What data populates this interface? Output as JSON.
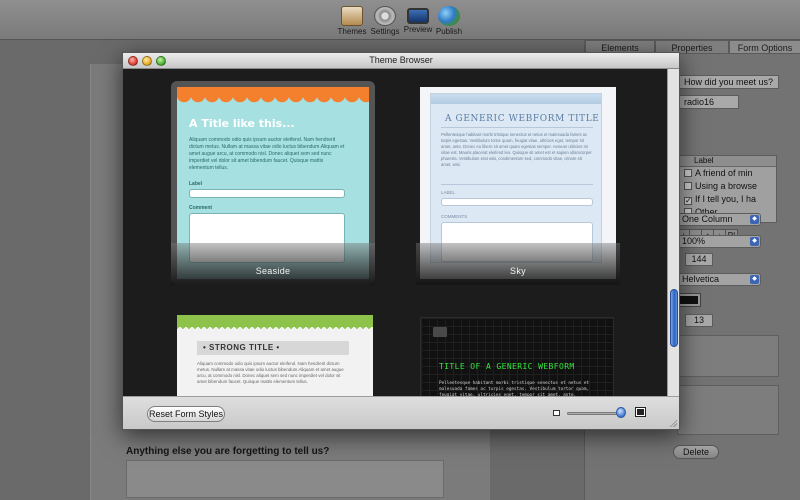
{
  "toolbar": {
    "buttons": [
      {
        "label": "Themes",
        "icon": "themes-icon"
      },
      {
        "label": "Settings",
        "icon": "gear-icon"
      },
      {
        "label": "Preview",
        "icon": "monitor-icon"
      },
      {
        "label": "Publish",
        "icon": "globe-icon"
      }
    ]
  },
  "inspector": {
    "tabs": [
      "Elements",
      "Properties",
      "Form Options"
    ],
    "question_field": "How did you meet us?",
    "name_field": "radio16",
    "list_header": "Label",
    "list_items": [
      {
        "label": "A friend of min",
        "checked": false
      },
      {
        "label": "Using a browse",
        "checked": false
      },
      {
        "label": "If I tell you, I ha",
        "checked": true
      },
      {
        "label": "Other...",
        "checked": false
      }
    ],
    "list_tools": [
      "+",
      "-",
      "↑",
      "↓",
      "P|"
    ],
    "layout_select": "One Column",
    "width_select": "100%",
    "width_value": "144",
    "font_select": "Helvetica",
    "font_size": "13",
    "delete_label": "Delete"
  },
  "background": {
    "bottom_question": "Anything else you are forgetting to tell us?"
  },
  "theme_browser": {
    "title": "Theme Browser",
    "reset_label": "Reset Form Styles",
    "themes": [
      {
        "name": "Seaside",
        "preview_title": "A Title like this...",
        "preview_text": "Aliquam commodo odio quis ipsum auctor eleifend. Nam hendrerit dictum metus. Nullam at massa vitae odio luctus bibendum.Aliquam et amet augue arcu, at commodo nisl. Donec aliquet sem sed nunc imperdiet vel dolor sit amet bibendum faucet. Quisque mattis elementum tellus.",
        "label1": "Label",
        "label2": "Comment",
        "selected": true
      },
      {
        "name": "Sky",
        "preview_title": "A GENERIC WEBFORM TITLE",
        "preview_text": "Pellentesque habitant morbi tristique senectus et netus et malesuada fames ac turpis egestas. Vestibulum tortor quam, feugiat vitae, ultricies eget, tempor sit amet, ante. Donec eu libero sit amet quam egestas semper. Aenean ultricies mi vitae est. Mauris placerat eleifend leo. Quisque sit amet est et sapien ullamcorper pharetra. Vestibulum erat wisi, condimentum sed, commodo vitae, ornare sit amet, wisi.",
        "label1": "LABEL",
        "label2": "COMMENTS",
        "selected": false
      },
      {
        "name": "",
        "preview_title": "• STRONG TITLE •",
        "preview_text": "Aliquam commodo odio quis ipsum auctor eleifend. Nam hendrerit dictum metus. Nullam at massa vitae odio luctus bibendum.Aliquam et amet augue arcu, at commodo nisl. Donec aliquet sem sed nunc imperdiet vel dolor sit amet bibendum faucet. Quisque mattis elementum tellus.",
        "selected": false
      },
      {
        "name": "",
        "preview_title": "TITLE OF A GENERIC WEBFORM",
        "preview_text": "Pellentesque habitant morbi tristique senectus et netus et malesuada fames ac turpis egestas. Vestibulum tortor quam, feugiat vitae, ultricies eget, tempor sit amet, ante.",
        "selected": false
      }
    ]
  },
  "colors": {
    "accent_blue": "#2d63c3",
    "seaside_orange": "#f47f2c",
    "seaside_bg": "#a6e0e0",
    "terminal_green": "#33e63a",
    "strong_green": "#8dc34a"
  }
}
